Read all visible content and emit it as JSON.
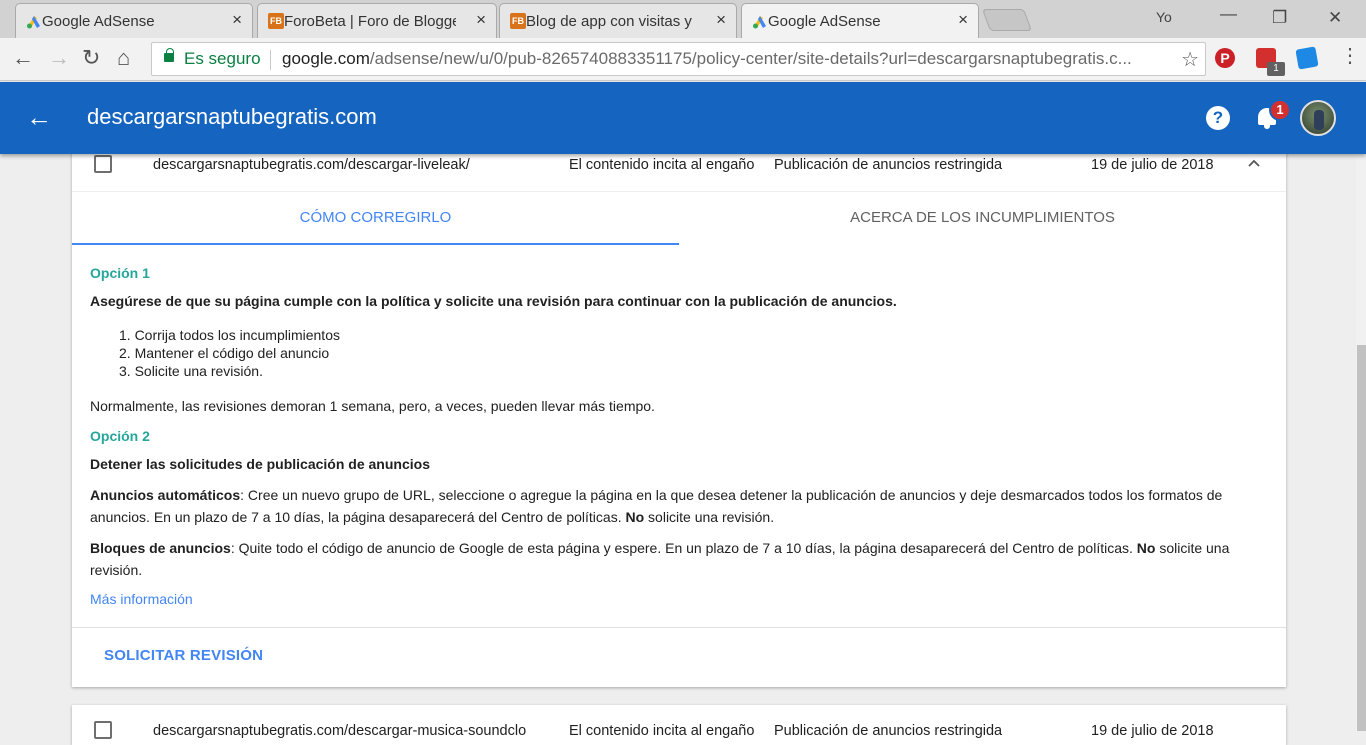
{
  "browser": {
    "tabs": [
      {
        "title": "Google AdSense",
        "icon": "adsense-icon"
      },
      {
        "title": "ForoBeta | Foro de Blogge",
        "icon": "forobeta-icon"
      },
      {
        "title": "Blog de app con visitas y",
        "icon": "forobeta-icon"
      },
      {
        "title": "Google AdSense",
        "icon": "adsense-icon"
      }
    ],
    "tab_close": "×",
    "fb_label": "FB",
    "user_label": "Yo",
    "secure_label": "Es seguro",
    "url_domain": "google.com",
    "url_path": "/adsense/new/u/0/pub-8265740883351175/policy-center/site-details?url=descargarsnaptubegratis.c...",
    "ext_badge": "1"
  },
  "app": {
    "site_title": "descargarsnaptubegratis.com",
    "notifications_count": "1",
    "help_label": "?"
  },
  "issue": {
    "url": "descargarsnaptubegratis.com/descargar-liveleak/",
    "violation": "El contenido incita al engaño",
    "status": "Publicación de anuncios restringida",
    "date": "19 de julio de 2018"
  },
  "tabs": {
    "fix": "CÓMO CORREGIRLO",
    "about": "ACERCA DE LOS INCUMPLIMIENTOS"
  },
  "option1": {
    "label": "Opción 1",
    "heading": "Asegúrese de que su página cumple con la política y solicite una revisión para continuar con la publicación de anuncios.",
    "steps": [
      "1. Corrija todos los incumplimientos",
      "2. Mantener el código del anuncio",
      "3. Solicite una revisión."
    ],
    "note": "Normalmente, las revisiones demoran 1 semana, pero, a veces, pueden llevar más tiempo."
  },
  "option2": {
    "label": "Opción 2",
    "heading": "Detener las solicitudes de publicación de anuncios",
    "auto_title": "Anuncios automáticos",
    "auto_text": ": Cree un nuevo grupo de URL, seleccione o agregue la página en la que desea detener la publicación de anuncios y deje desmarcados todos los formatos de anuncios. En un plazo de 7 a 10 días, la página desaparecerá del Centro de políticas. ",
    "auto_no": "No",
    "auto_end": " solicite una revisión.",
    "blocks_title": "Bloques de anuncios",
    "blocks_text": ": Quite todo el código de anuncio de Google de esta página y espere. En un plazo de 7 a 10 días, la página desaparecerá del Centro de políticas. ",
    "blocks_no": "No",
    "blocks_end": " solicite una revisión."
  },
  "more_info": "Más información",
  "request_review": "SOLICITAR REVISIÓN",
  "issue2": {
    "url": "descargarsnaptubegratis.com/descargar-musica-soundclo",
    "violation": "El contenido incita al engaño",
    "status": "Publicación de anuncios restringida",
    "date": "19 de julio de 2018"
  },
  "colors": {
    "appbar": "#1565c0",
    "accent": "#4285f4",
    "option_label": "#26a69a"
  }
}
